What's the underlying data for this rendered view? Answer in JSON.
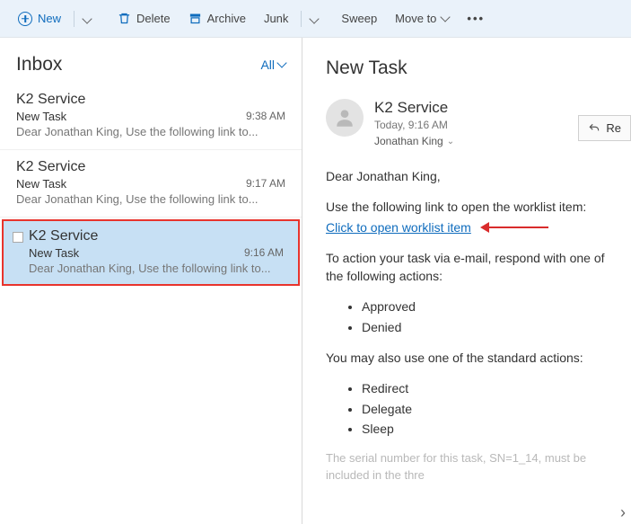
{
  "toolbar": {
    "new": "New",
    "delete": "Delete",
    "archive": "Archive",
    "junk": "Junk",
    "sweep": "Sweep",
    "moveto": "Move to"
  },
  "list": {
    "title": "Inbox",
    "filter": "All",
    "items": [
      {
        "from": "K2 Service",
        "subject": "New Task",
        "time": "9:38 AM",
        "preview": "Dear Jonathan King, Use the following link to..."
      },
      {
        "from": "K2 Service",
        "subject": "New Task",
        "time": "9:17 AM",
        "preview": "Dear Jonathan King, Use the following link to..."
      },
      {
        "from": "K2 Service",
        "subject": "New Task",
        "time": "9:16 AM",
        "preview": "Dear Jonathan King, Use the following link to..."
      }
    ]
  },
  "message": {
    "subject": "New Task",
    "from": "K2 Service",
    "date": "Today, 9:16 AM",
    "to": "Jonathan King",
    "reply": "Re",
    "body": {
      "greeting": "Dear Jonathan King,",
      "intro": "Use the following link to open the worklist item:",
      "link": "Click to open worklist item",
      "actions_intro": "To action your task via e-mail, respond with one of the following actions:",
      "actions": [
        "Approved",
        "Denied"
      ],
      "std_intro": "You may also use one of the standard actions:",
      "std_actions": [
        "Redirect",
        "Delegate",
        "Sleep"
      ],
      "serial": "The serial number for this task, SN=1_14, must be included in the thre"
    }
  }
}
